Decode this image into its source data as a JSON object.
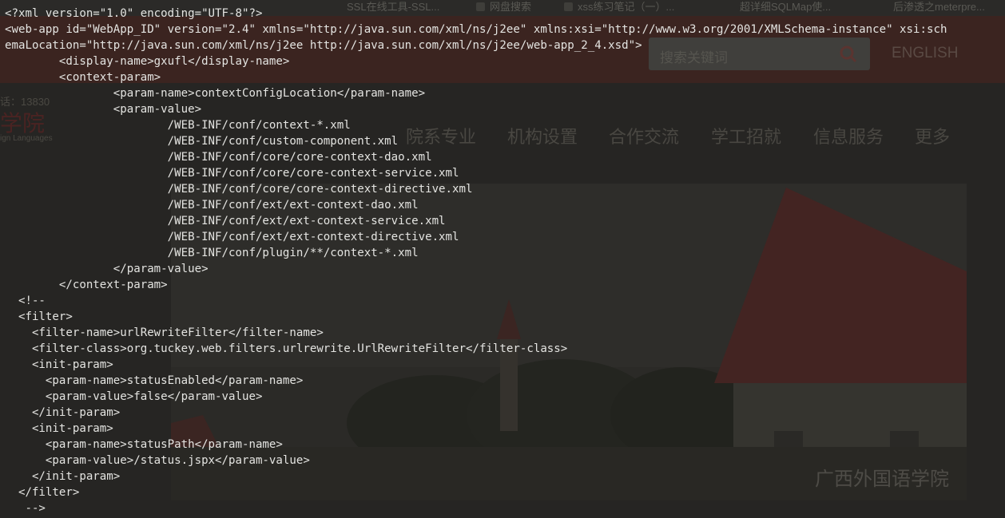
{
  "background_page": {
    "tabs": [
      {
        "label": "SSL在线工具-SSL..."
      },
      {
        "label": "网盘搜索"
      },
      {
        "label": "xss练习笔记（一）..."
      },
      {
        "label": "超详细SQLMap使..."
      },
      {
        "label": "后渗透之meterpre..."
      }
    ],
    "search": {
      "placeholder": "搜索关键词"
    },
    "lang_link": "ENGLISH",
    "phone_fragment": "话：13830",
    "logo_text": "学院",
    "logo_sub": "ign Languages",
    "nav": [
      {
        "label": "院系专业"
      },
      {
        "label": "机构设置"
      },
      {
        "label": "合作交流"
      },
      {
        "label": "学工招就"
      },
      {
        "label": "信息服务"
      },
      {
        "label": "更多"
      }
    ],
    "banner_caption": "广西外国语学院"
  },
  "source_lines": [
    "<?xml version=\"1.0\" encoding=\"UTF-8\"?>",
    "<web-app id=\"WebApp_ID\" version=\"2.4\" xmlns=\"http://java.sun.com/xml/ns/j2ee\" xmlns:xsi=\"http://www.w3.org/2001/XMLSchema-instance\" xsi:sch",
    "emaLocation=\"http://java.sun.com/xml/ns/j2ee http://java.sun.com/xml/ns/j2ee/web-app_2_4.xsd\">",
    "        <display-name>gxufl</display-name>",
    "        <context-param>",
    "                <param-name>contextConfigLocation</param-name>",
    "                <param-value>",
    "                        /WEB-INF/conf/context-*.xml",
    "                        /WEB-INF/conf/custom-component.xml",
    "                        /WEB-INF/conf/core/core-context-dao.xml",
    "                        /WEB-INF/conf/core/core-context-service.xml",
    "                        /WEB-INF/conf/core/core-context-directive.xml",
    "                        /WEB-INF/conf/ext/ext-context-dao.xml",
    "                        /WEB-INF/conf/ext/ext-context-service.xml",
    "                        /WEB-INF/conf/ext/ext-context-directive.xml",
    "                        /WEB-INF/conf/plugin/**/context-*.xml",
    "                </param-value>",
    "        </context-param>",
    "  <!--",
    "  <filter>",
    "    <filter-name>urlRewriteFilter</filter-name>",
    "    <filter-class>org.tuckey.web.filters.urlrewrite.UrlRewriteFilter</filter-class>",
    "    <init-param>",
    "      <param-name>statusEnabled</param-name>",
    "      <param-value>false</param-value>",
    "    </init-param>",
    "    <init-param>",
    "      <param-name>statusPath</param-name>",
    "      <param-value>/status.jspx</param-value>",
    "    </init-param>",
    "  </filter>",
    "   -->"
  ],
  "colors": {
    "text": "#e4e4e1",
    "overlay_bg": "#262523",
    "header_dim": "#3b2420"
  }
}
